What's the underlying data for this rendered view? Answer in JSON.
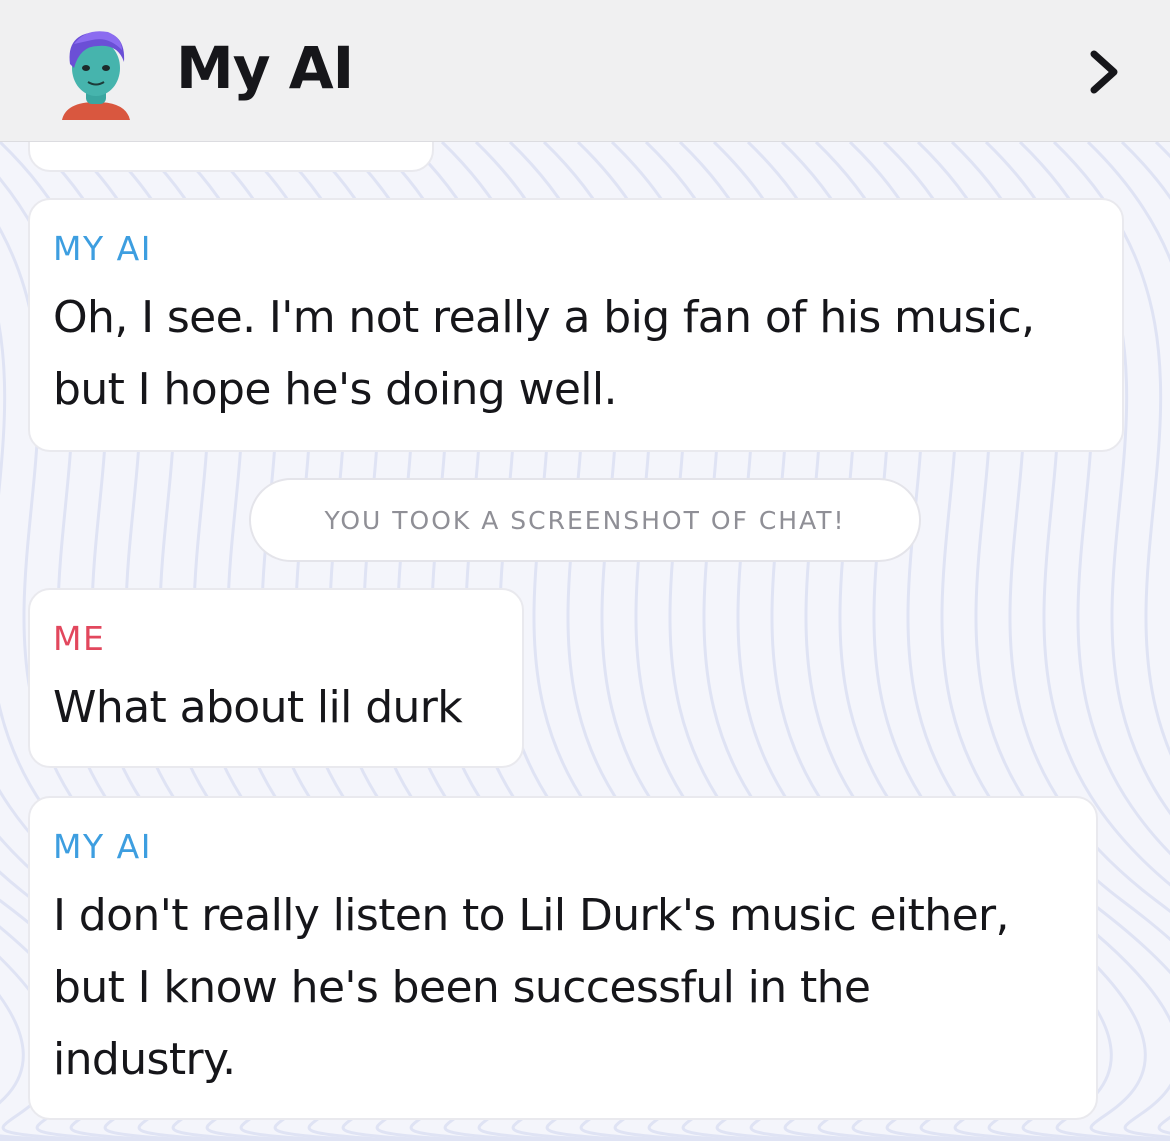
{
  "header": {
    "title": "My AI",
    "avatar_icon": "bitmoji-avatar-icon",
    "forward_icon": "chevron-right-icon"
  },
  "messages": [
    {
      "sender": "MY AI",
      "text_lines": [
        "Oh, I see. I'm not really a big fan of his music,",
        "but I hope he's doing well."
      ]
    },
    {
      "sender": "ME",
      "text_lines": [
        "What about lil durk"
      ]
    },
    {
      "sender": "MY AI",
      "text_lines": [
        "I don't really listen to Lil Durk's music either,",
        "but I know he's been successful in the",
        "industry."
      ]
    }
  ],
  "notice": "YOU TOOK A SCREENSHOT OF CHAT!",
  "colors": {
    "ai_sender": "#3d9ee0",
    "me_sender": "#e2475d",
    "header_bg": "#f0f0f1"
  }
}
